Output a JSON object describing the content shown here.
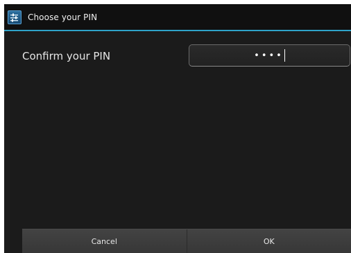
{
  "dialog": {
    "title": "Choose your PIN",
    "app_icon": "settings-app-icon"
  },
  "form": {
    "prompt": "Confirm your PIN",
    "pin_masked": "••••"
  },
  "buttons": {
    "cancel_label": "Cancel",
    "ok_label": "OK"
  },
  "colors": {
    "accent": "#2ea3c9",
    "background": "#1b1b1b",
    "title_bar": "#101010"
  }
}
